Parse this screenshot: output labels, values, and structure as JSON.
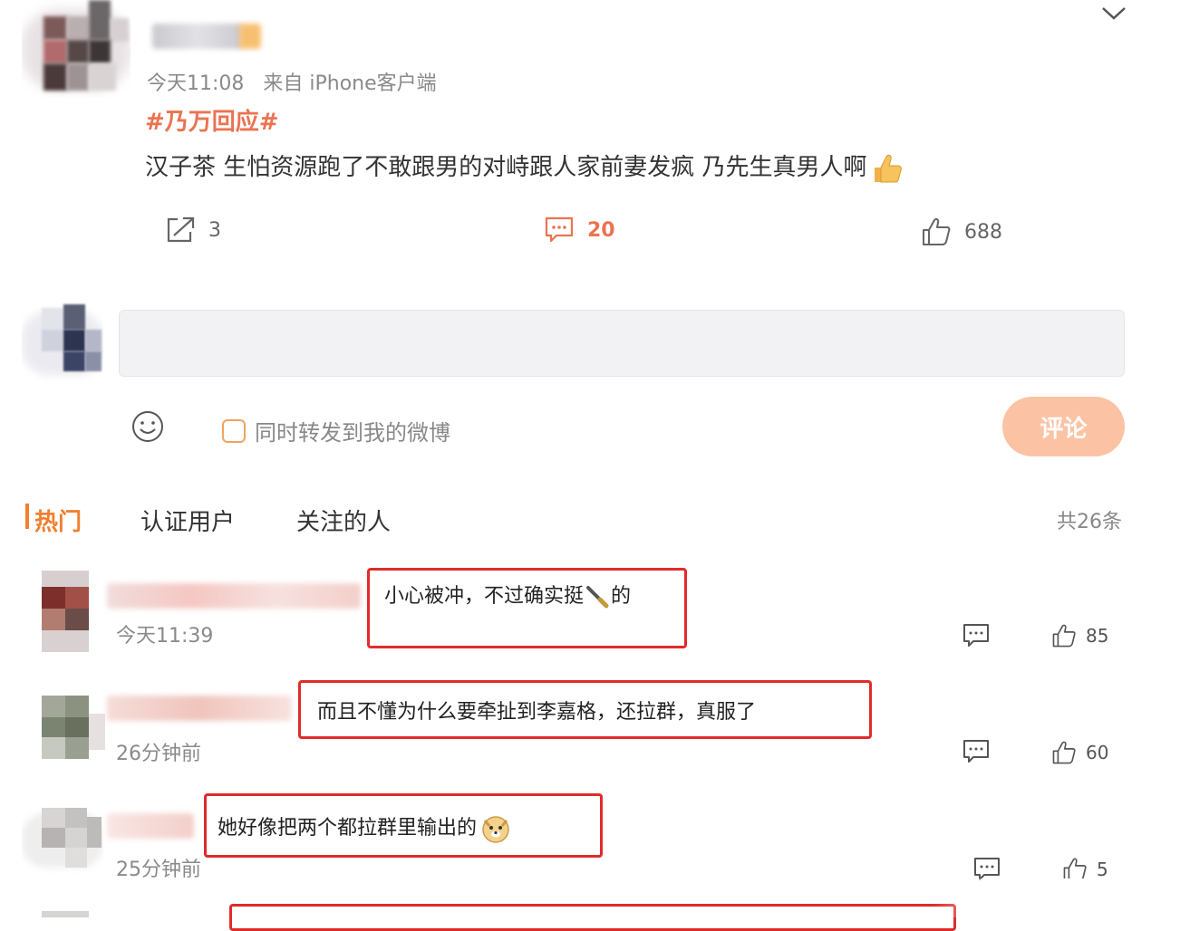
{
  "post": {
    "time": "今天11:08",
    "source": "来自 iPhone客户端",
    "topic": "#乃万回应#",
    "text": "汉子茶 生怕资源跑了不敢跟男的对峙跟人家前妻发疯 乃先生真男人啊",
    "repost_count": "3",
    "comment_count": "20",
    "like_count": "688"
  },
  "composer": {
    "repost_label": "同时转发到我的微博",
    "submit_label": "评论"
  },
  "tabs": {
    "hot": "热门",
    "verified": "认证用户",
    "following": "关注的人",
    "total": "共26条"
  },
  "comments": [
    {
      "text": "小心被冲，不过确实挺",
      "text_suffix": "的",
      "time": "今天11:39",
      "likes": "85"
    },
    {
      "text": "而且不懂为什么要牵扯到李嘉格，还拉群，真服了",
      "time": "26分钟前",
      "likes": "60"
    },
    {
      "text": "她好像把两个都拉群里输出的",
      "time": "25分钟前",
      "likes": "5"
    }
  ],
  "icons": {
    "collapse": "chevron-down-icon",
    "repost": "repost-icon",
    "comment": "comment-icon",
    "like": "thumbs-up-icon",
    "emoji": "smiley-icon"
  },
  "colors": {
    "accent": "#eb7350",
    "highlight_box": "#e02b2b",
    "submit_bg": "#fbc3a4"
  }
}
